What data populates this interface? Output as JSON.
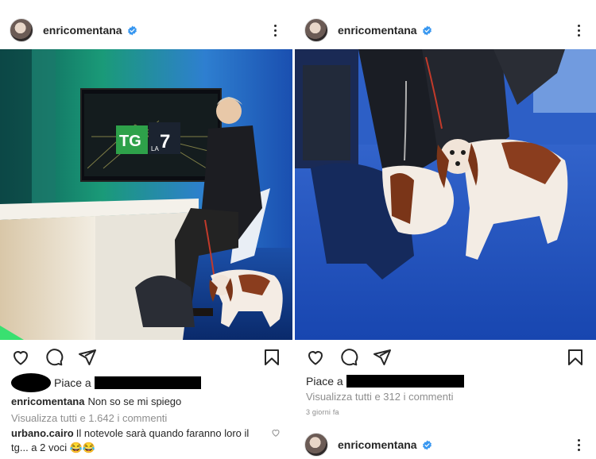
{
  "left_post": {
    "username": "enricomentana",
    "likes_prefix": "Piace a",
    "caption_user": "enricomentana",
    "caption_text": "Non so se mi spiego",
    "view_comments": "Visualizza tutti e 1.642 i commenti",
    "comment": {
      "user": "urbano.cairo",
      "text": "Il notevole sarà quando faranno loro il tg... a 2 voci",
      "emoji": "😂😂"
    },
    "tv_logo_text": "TG",
    "tv_logo_sub": "LA",
    "tv_logo_num": "7"
  },
  "right_post": {
    "username": "enricomentana",
    "likes_prefix": "Piace a",
    "view_comments": "Visualizza tutti e 312 i commenti",
    "time_ago": "3 giorni fa"
  },
  "next_post": {
    "username": "enricomentana"
  },
  "icons": {
    "like": "heart-icon",
    "comment": "comment-icon",
    "share": "paper-plane-icon",
    "save": "bookmark-icon",
    "verified": "verified-badge-icon",
    "more": "more-options-icon"
  },
  "colors": {
    "verified": "#3897f0",
    "text": "#262626",
    "muted": "#8e8e8e"
  }
}
